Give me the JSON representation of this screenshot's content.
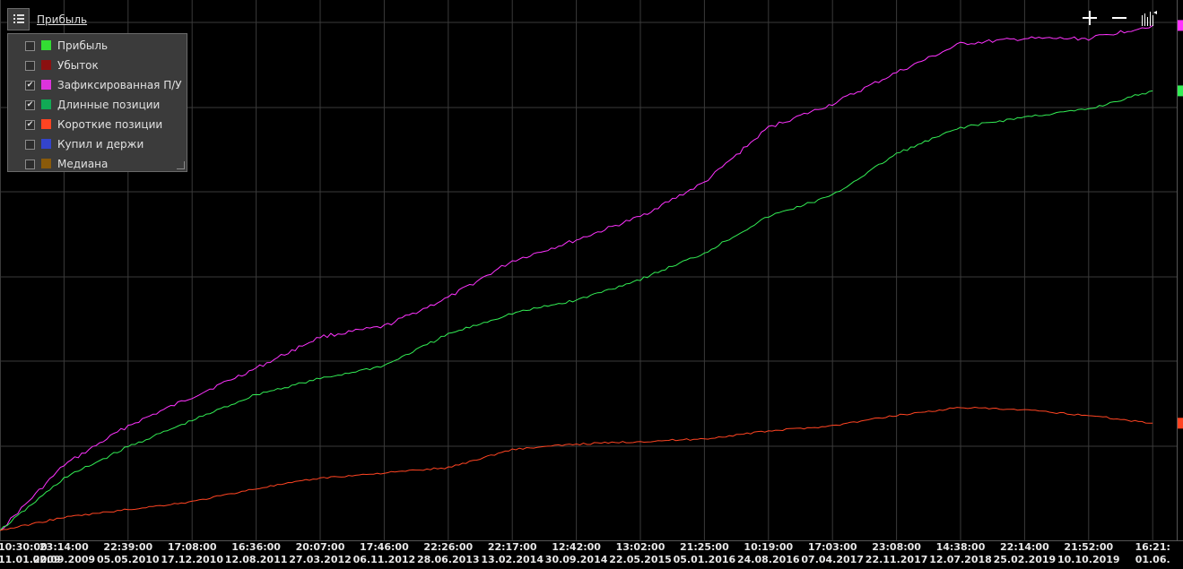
{
  "header": {
    "title": "Прибыль"
  },
  "legend": {
    "items": [
      {
        "label": "Прибыль",
        "checked": false,
        "color": "#33dd33"
      },
      {
        "label": "Убыток",
        "checked": false,
        "color": "#8b1010"
      },
      {
        "label": "Зафиксированная П/У",
        "checked": true,
        "color": "#dd33dd"
      },
      {
        "label": "Длинные позиции",
        "checked": true,
        "color": "#11aa55"
      },
      {
        "label": "Короткие позиции",
        "checked": true,
        "color": "#ff4422"
      },
      {
        "label": "Купил и держи",
        "checked": false,
        "color": "#3344cc"
      },
      {
        "label": "Медиана",
        "checked": false,
        "color": "#8a5a0a"
      }
    ]
  },
  "toolbar": {
    "zoom_in_icon": "plus-icon",
    "zoom_out_icon": "minus-icon",
    "fit_icon": "fit-chart-icon"
  },
  "chart_data": {
    "type": "line",
    "x": [
      {
        "time": "10:30:00",
        "date": "11.01.2009"
      },
      {
        "time": "23:14:00",
        "date": "02.09.2009"
      },
      {
        "time": "22:39:00",
        "date": "05.05.2010"
      },
      {
        "time": "17:08:00",
        "date": "17.12.2010"
      },
      {
        "time": "16:36:00",
        "date": "12.08.2011"
      },
      {
        "time": "20:07:00",
        "date": "27.03.2012"
      },
      {
        "time": "17:46:00",
        "date": "06.11.2012"
      },
      {
        "time": "22:26:00",
        "date": "28.06.2013"
      },
      {
        "time": "22:17:00",
        "date": "13.02.2014"
      },
      {
        "time": "12:42:00",
        "date": "30.09.2014"
      },
      {
        "time": "13:02:00",
        "date": "22.05.2015"
      },
      {
        "time": "21:25:00",
        "date": "05.01.2016"
      },
      {
        "time": "10:19:00",
        "date": "24.08.2016"
      },
      {
        "time": "17:03:00",
        "date": "07.04.2017"
      },
      {
        "time": "23:08:00",
        "date": "22.11.2017"
      },
      {
        "time": "14:38:00",
        "date": "12.07.2018"
      },
      {
        "time": "22:14:00",
        "date": "25.02.2019"
      },
      {
        "time": "21:52:00",
        "date": "10.10.2019"
      },
      {
        "time": "16:21:",
        "date": "01.06."
      }
    ],
    "series": [
      {
        "name": "Зафиксированная П/У",
        "color": "#ff33ff",
        "values": [
          0,
          12.5,
          20,
          25.5,
          31,
          37,
          39,
          44.5,
          51.5,
          55.5,
          60,
          66.5,
          77,
          81.5,
          87.5,
          93,
          94,
          94,
          96.5
        ]
      },
      {
        "name": "Длинные позиции",
        "color": "#33ee55",
        "values": [
          0,
          10,
          16,
          21,
          26,
          29,
          31.5,
          37.5,
          41.5,
          44,
          48,
          53,
          60,
          64,
          72,
          77,
          79,
          80.5,
          84
        ]
      },
      {
        "name": "Короткие позиции",
        "color": "#ff4422",
        "values": [
          0,
          2.5,
          4,
          5.5,
          8,
          10,
          11,
          12,
          15.5,
          16.5,
          17,
          17.5,
          19,
          20,
          22,
          23.5,
          23,
          22,
          20.5
        ]
      }
    ],
    "ylim": [
      0,
      100
    ],
    "grid": true,
    "legend_position": "top-left"
  }
}
